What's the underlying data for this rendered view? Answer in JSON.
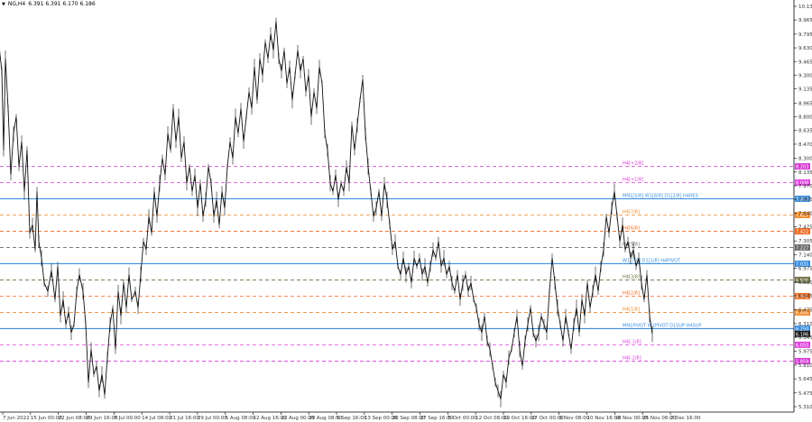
{
  "header": {
    "dropdown_icon": "triangle-down-icon",
    "symbol": "NG,H4",
    "ohlc": "6.391 6.391 6.170 6.186"
  },
  "price_axis": {
    "labels": [
      "10.130",
      "9.965",
      "9.795",
      "9.630",
      "9.465",
      "9.300",
      "9.135",
      "8.965",
      "8.800",
      "8.635",
      "8.470",
      "8.300",
      "8.135",
      "7.970",
      "7.805",
      "7.640",
      "7.475",
      "7.305",
      "7.140",
      "6.975",
      "6.810",
      "6.645",
      "6.475",
      "6.310",
      "6.145",
      "5.975",
      "5.810",
      "5.645",
      "5.475",
      "5.310"
    ]
  },
  "time_axis": {
    "labels": [
      "7 Jun 2022",
      "15 Jun 00:00",
      "22 Jun 08:00",
      "29 Jun 16:00",
      "7 Jul 00:00",
      "14 Jul 08:00",
      "21 Jul 16:00",
      "29 Jul 00:00",
      "5 Aug 08:00",
      "12 Aug 16:00",
      "22 Aug 00:00",
      "29 Aug 08:00",
      "5 Sep 16:00",
      "13 Sep 00:00",
      "20 Sep 08:00",
      "27 Sep 16:00",
      "5 Oct 00:00",
      "12 Oct 08:00",
      "19 Oct 16:00",
      "27 Oct 00:00",
      "3 Nov 08:00",
      "10 Nov 16:00",
      "18 Nov 00:00",
      "25 Nov 08:00",
      "2 Dec 16:00"
    ]
  },
  "levels": [
    {
      "label": "H4[+2/8]",
      "tag": "8.203",
      "price": 8.203,
      "color": "#d63ad6",
      "style": "dash"
    },
    {
      "label": "H4[+1/8]",
      "tag": "8.008",
      "price": 8.008,
      "color": "#e040e0",
      "style": "dash"
    },
    {
      "label": "MN1[5/8] W1[8/8] D1[2/8] H4RES",
      "tag": "7.813",
      "price": 7.813,
      "color": "#3b8fe0",
      "style": "solid"
    },
    {
      "label": "H4[7/8]",
      "tag": "7.617",
      "price": 7.617,
      "color": "#f08a2a",
      "style": "dash"
    },
    {
      "label": "H4[6/8]",
      "tag": "7.422",
      "price": 7.422,
      "color": "#f06a20",
      "style": "dash"
    },
    {
      "label": "H4[5/8]",
      "tag": "7.227",
      "price": 7.227,
      "color": "#6b6b6b",
      "style": "dash"
    },
    {
      "label": "W1[7/8] D1[1/8] H4PIVOT",
      "tag": "7.031",
      "price": 7.031,
      "color": "#3b8fe0",
      "style": "solid"
    },
    {
      "label": "H4[3/8]",
      "tag": "6.836",
      "price": 6.836,
      "color": "#6e6e40",
      "style": "dash"
    },
    {
      "label": "H4[2/8]",
      "tag": "6.641",
      "price": 6.641,
      "color": "#f06a20",
      "style": "dash"
    },
    {
      "label": "H4[1/8]",
      "tag": "6.445",
      "price": 6.445,
      "color": "#f08a2a",
      "style": "dash"
    },
    {
      "label": "MN1PIVOT W1PIVOT D1SUP H4SUP",
      "tag": "6.250",
      "price": 6.25,
      "color": "#3b8fe0",
      "style": "solid"
    },
    {
      "label": "H4[-1/8]",
      "tag": "6.055",
      "price": 6.055,
      "color": "#e040e0",
      "style": "dash"
    },
    {
      "label": "H4[-2/8]",
      "tag": "5.859",
      "price": 5.859,
      "color": "#d63ad6",
      "style": "dash"
    }
  ],
  "current_price": {
    "tag": "6.186",
    "price": 6.186,
    "color": "#1c1c1c"
  },
  "series": {
    "anchors": [
      [
        0,
        9.55
      ],
      [
        2,
        9.35
      ],
      [
        4,
        8.4
      ],
      [
        6,
        9.5
      ],
      [
        9,
        8.9
      ],
      [
        12,
        8.1
      ],
      [
        15,
        8.6
      ],
      [
        18,
        8.8
      ],
      [
        21,
        8.2
      ],
      [
        24,
        8.5
      ],
      [
        27,
        7.9
      ],
      [
        30,
        8.4
      ],
      [
        33,
        7.4
      ],
      [
        36,
        7.5
      ],
      [
        39,
        7.2
      ],
      [
        41,
        7.9
      ],
      [
        43,
        7.3
      ],
      [
        46,
        7.1
      ],
      [
        49,
        6.8
      ],
      [
        53,
        6.7
      ],
      [
        57,
        6.95
      ],
      [
        61,
        6.6
      ],
      [
        64,
        7.0
      ],
      [
        67,
        6.4
      ],
      [
        70,
        6.6
      ],
      [
        73,
        6.3
      ],
      [
        76,
        6.45
      ],
      [
        79,
        6.2
      ],
      [
        82,
        6.3
      ],
      [
        85,
        6.7
      ],
      [
        88,
        6.9
      ],
      [
        92,
        6.7
      ],
      [
        95,
        6.3
      ],
      [
        98,
        5.6
      ],
      [
        101,
        6.0
      ],
      [
        104,
        5.7
      ],
      [
        107,
        5.8
      ],
      [
        110,
        5.5
      ],
      [
        113,
        5.7
      ],
      [
        116,
        5.45
      ],
      [
        119,
        5.9
      ],
      [
        122,
        6.3
      ],
      [
        125,
        6.5
      ],
      [
        128,
        6.0
      ],
      [
        131,
        6.7
      ],
      [
        134,
        6.4
      ],
      [
        137,
        6.8
      ],
      [
        140,
        6.5
      ],
      [
        143,
        6.9
      ],
      [
        146,
        6.6
      ],
      [
        150,
        6.7
      ],
      [
        153,
        6.5
      ],
      [
        156,
        6.9
      ],
      [
        159,
        7.3
      ],
      [
        162,
        7.2
      ],
      [
        165,
        7.6
      ],
      [
        168,
        7.4
      ],
      [
        171,
        7.9
      ],
      [
        174,
        7.6
      ],
      [
        177,
        8.0
      ],
      [
        180,
        8.3
      ],
      [
        183,
        8.1
      ],
      [
        186,
        8.6
      ],
      [
        189,
        8.4
      ],
      [
        192,
        8.9
      ],
      [
        195,
        8.5
      ],
      [
        198,
        8.8
      ],
      [
        201,
        8.3
      ],
      [
        204,
        8.5
      ],
      [
        207,
        8.0
      ],
      [
        210,
        8.2
      ],
      [
        213,
        7.9
      ],
      [
        216,
        8.1
      ],
      [
        219,
        7.7
      ],
      [
        222,
        8.0
      ],
      [
        225,
        7.6
      ],
      [
        228,
        7.8
      ],
      [
        231,
        8.2
      ],
      [
        234,
        8.0
      ],
      [
        237,
        7.6
      ],
      [
        240,
        7.8
      ],
      [
        243,
        7.5
      ],
      [
        246,
        7.9
      ],
      [
        249,
        7.7
      ],
      [
        252,
        8.2
      ],
      [
        255,
        8.5
      ],
      [
        258,
        8.3
      ],
      [
        261,
        8.8
      ],
      [
        264,
        8.6
      ],
      [
        267,
        8.9
      ],
      [
        270,
        8.5
      ],
      [
        273,
        8.8
      ],
      [
        276,
        9.1
      ],
      [
        279,
        8.9
      ],
      [
        282,
        9.4
      ],
      [
        285,
        9.0
      ],
      [
        288,
        9.5
      ],
      [
        291,
        9.3
      ],
      [
        294,
        9.7
      ],
      [
        297,
        9.5
      ],
      [
        300,
        9.8
      ],
      [
        303,
        9.6
      ],
      [
        306,
        9.95
      ],
      [
        309,
        9.5
      ],
      [
        312,
        9.35
      ],
      [
        315,
        9.6
      ],
      [
        318,
        9.2
      ],
      [
        321,
        9.4
      ],
      [
        324,
        9.0
      ],
      [
        327,
        9.3
      ],
      [
        330,
        9.6
      ],
      [
        333,
        9.35
      ],
      [
        336,
        9.5
      ],
      [
        339,
        9.1
      ],
      [
        342,
        9.3
      ],
      [
        345,
        8.8
      ],
      [
        348,
        9.1
      ],
      [
        351,
        8.9
      ],
      [
        354,
        9.4
      ],
      [
        357,
        9.2
      ],
      [
        360,
        8.6
      ],
      [
        363,
        8.4
      ],
      [
        366,
        8.0
      ],
      [
        369,
        7.9
      ],
      [
        372,
        8.1
      ],
      [
        375,
        7.8
      ],
      [
        378,
        8.0
      ],
      [
        381,
        7.9
      ],
      [
        384,
        8.2
      ],
      [
        387,
        8.0
      ],
      [
        390,
        8.7
      ],
      [
        393,
        8.4
      ],
      [
        396,
        8.7
      ],
      [
        399,
        9.0
      ],
      [
        402,
        9.25
      ],
      [
        405,
        8.6
      ],
      [
        408,
        8.2
      ],
      [
        411,
        7.9
      ],
      [
        414,
        7.6
      ],
      [
        417,
        7.7
      ],
      [
        420,
        7.9
      ],
      [
        423,
        7.6
      ],
      [
        426,
        8.0
      ],
      [
        429,
        7.8
      ],
      [
        432,
        7.5
      ],
      [
        435,
        7.2
      ],
      [
        438,
        7.3
      ],
      [
        441,
        7.0
      ],
      [
        444,
        6.9
      ],
      [
        447,
        7.1
      ],
      [
        450,
        6.9
      ],
      [
        453,
        7.0
      ],
      [
        456,
        6.8
      ],
      [
        459,
        7.1
      ],
      [
        462,
        7.0
      ],
      [
        465,
        7.1
      ],
      [
        468,
        6.9
      ],
      [
        471,
        7.0
      ],
      [
        474,
        6.8
      ],
      [
        477,
        7.0
      ],
      [
        480,
        7.2
      ],
      [
        483,
        7.1
      ],
      [
        486,
        7.3
      ],
      [
        489,
        7.0
      ],
      [
        492,
        7.1
      ],
      [
        495,
        6.9
      ],
      [
        498,
        7.0
      ],
      [
        501,
        6.8
      ],
      [
        504,
        6.7
      ],
      [
        507,
        6.9
      ],
      [
        510,
        6.6
      ],
      [
        513,
        6.8
      ],
      [
        516,
        6.9
      ],
      [
        519,
        6.7
      ],
      [
        522,
        6.8
      ],
      [
        525,
        6.6
      ],
      [
        528,
        6.5
      ],
      [
        531,
        6.3
      ],
      [
        534,
        6.2
      ],
      [
        537,
        6.4
      ],
      [
        540,
        6.1
      ],
      [
        543,
        6.0
      ],
      [
        546,
        5.8
      ],
      [
        549,
        5.6
      ],
      [
        552,
        5.5
      ],
      [
        555,
        5.4
      ],
      [
        558,
        5.7
      ],
      [
        561,
        5.6
      ],
      [
        564,
        5.9
      ],
      [
        567,
        6.0
      ],
      [
        570,
        6.2
      ],
      [
        573,
        6.4
      ],
      [
        576,
        6.0
      ],
      [
        579,
        5.8
      ],
      [
        582,
        6.1
      ],
      [
        585,
        6.3
      ],
      [
        588,
        6.5
      ],
      [
        591,
        6.2
      ],
      [
        594,
        6.1
      ],
      [
        597,
        6.2
      ],
      [
        600,
        6.4
      ],
      [
        603,
        6.3
      ],
      [
        606,
        6.2
      ],
      [
        609,
        6.7
      ],
      [
        612,
        7.1
      ],
      [
        615,
        6.8
      ],
      [
        618,
        6.5
      ],
      [
        621,
        6.3
      ],
      [
        624,
        6.1
      ],
      [
        627,
        6.4
      ],
      [
        630,
        6.2
      ],
      [
        633,
        6.0
      ],
      [
        636,
        6.3
      ],
      [
        639,
        6.5
      ],
      [
        642,
        6.2
      ],
      [
        645,
        6.6
      ],
      [
        648,
        6.4
      ],
      [
        651,
        6.8
      ],
      [
        654,
        6.5
      ],
      [
        657,
        6.7
      ],
      [
        660,
        6.9
      ],
      [
        663,
        6.7
      ],
      [
        666,
        7.0
      ],
      [
        669,
        7.2
      ],
      [
        672,
        7.6
      ],
      [
        675,
        7.4
      ],
      [
        678,
        7.7
      ],
      [
        681,
        7.9
      ],
      [
        684,
        7.6
      ],
      [
        687,
        7.3
      ],
      [
        690,
        7.5
      ],
      [
        693,
        7.2
      ],
      [
        696,
        7.3
      ],
      [
        699,
        7.1
      ],
      [
        702,
        7.2
      ],
      [
        705,
        7.0
      ],
      [
        708,
        7.1
      ],
      [
        711,
        6.8
      ],
      [
        714,
        6.6
      ],
      [
        717,
        6.9
      ],
      [
        720,
        6.4
      ],
      [
        723,
        6.186
      ]
    ],
    "color": "#111111"
  },
  "colors": {
    "background": "#ffffff",
    "grid_line": "#dcdcdc",
    "axis_line": "#000000",
    "candle": "#111111"
  }
}
